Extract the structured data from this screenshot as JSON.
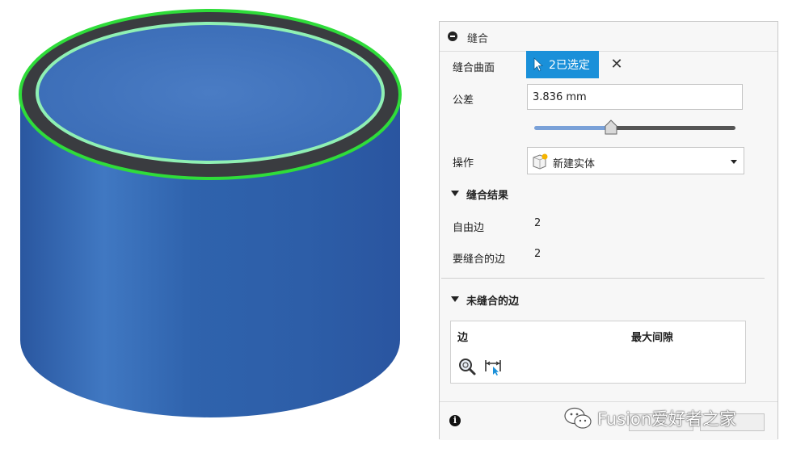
{
  "panel": {
    "title": "缝合",
    "stitch_surfaces": {
      "label": "缝合曲面",
      "button_text": "2已选定"
    },
    "tolerance": {
      "label": "公差",
      "value": "3.836 mm",
      "slider_fraction": 0.38
    },
    "operation": {
      "label": "操作",
      "selected": "新建实体"
    },
    "results": {
      "title": "缝合结果",
      "free_edges_label": "自由边",
      "free_edges_value": "2",
      "edges_to_stitch_label": "要缝合的边",
      "edges_to_stitch_value": "2"
    },
    "unstitched": {
      "title": "未缝合的边",
      "col_edge": "边",
      "col_max_gap": "最大间隙"
    }
  },
  "watermark": {
    "text": "Fusion爱好者之家"
  },
  "colors": {
    "accent": "#1a90d9",
    "cylinder_body": "#2f5fa8",
    "cylinder_highlight": "#3f79c4",
    "edge_highlight": "#2fdc3a",
    "slider_fill": "#7aa1d8"
  },
  "icons": {
    "select_button": "cursor-arrow-icon",
    "clear": "close-x-icon",
    "operation": "new-body-icon",
    "info": "info-icon",
    "zoom": "zoom-magnifier-icon",
    "measure": "gap-measure-icon",
    "watermark": "wechat-icon"
  }
}
